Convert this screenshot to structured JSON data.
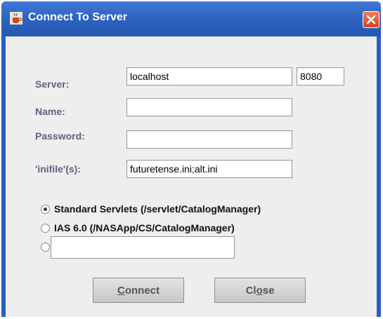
{
  "window": {
    "title": "Connect To Server",
    "app_icon": "java-cup-icon",
    "close_icon": "close-icon"
  },
  "form": {
    "server_label": "Server:",
    "server_value": "localhost",
    "port_value": "8080",
    "name_label": "Name:",
    "name_value": "",
    "password_label": "Password:",
    "password_value": "",
    "inifile_label": "'inifile'(s):",
    "inifile_value": "futuretense.ini;alt.ini"
  },
  "options": {
    "standard_label": "Standard Servlets  (/servlet/CatalogManager)",
    "standard_selected": true,
    "ias_label": "IAS 6.0  (/NASApp/CS/CatalogManager)",
    "ias_selected": false,
    "custom_selected": false,
    "custom_value": ""
  },
  "buttons": {
    "connect_mnemonic": "C",
    "connect_rest": "onnect",
    "close_first": "Cl",
    "close_mnemonic": "o",
    "close_rest": "se"
  },
  "colors": {
    "titlebar": "#2d62bf",
    "label": "#5b6383",
    "background": "#eeeeee",
    "close_button": "#d2442a"
  }
}
